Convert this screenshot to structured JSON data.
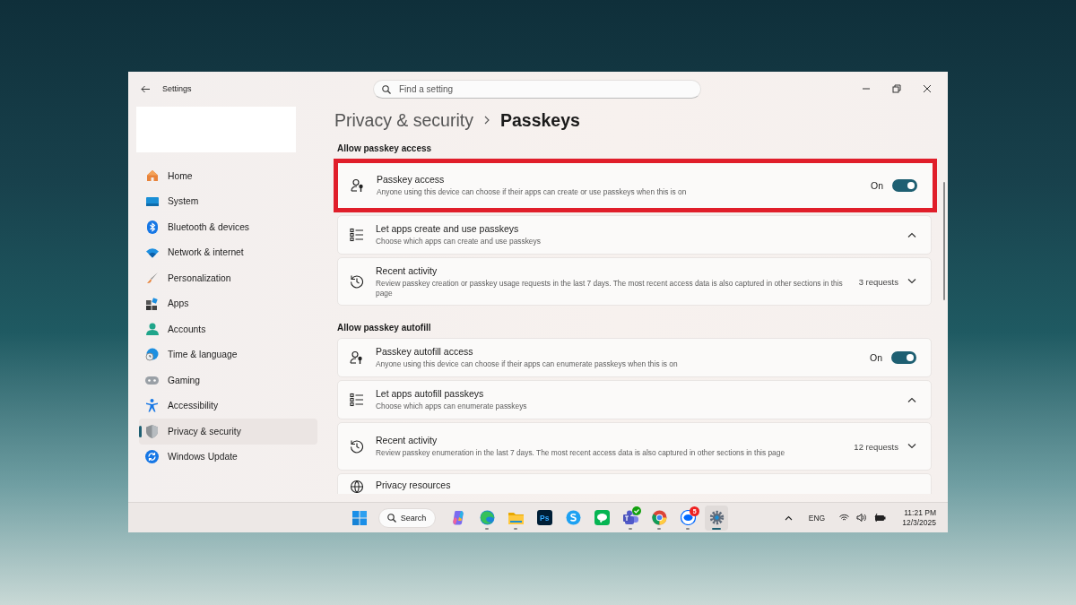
{
  "window": {
    "title": "Settings"
  },
  "search": {
    "placeholder": "Find a setting"
  },
  "sidebar": {
    "items": [
      {
        "label": "Home",
        "selected": false
      },
      {
        "label": "System",
        "selected": false
      },
      {
        "label": "Bluetooth & devices",
        "selected": false
      },
      {
        "label": "Network & internet",
        "selected": false
      },
      {
        "label": "Personalization",
        "selected": false
      },
      {
        "label": "Apps",
        "selected": false
      },
      {
        "label": "Accounts",
        "selected": false
      },
      {
        "label": "Time & language",
        "selected": false
      },
      {
        "label": "Gaming",
        "selected": false
      },
      {
        "label": "Accessibility",
        "selected": false
      },
      {
        "label": "Privacy & security",
        "selected": true
      },
      {
        "label": "Windows Update",
        "selected": false
      }
    ]
  },
  "breadcrumb": {
    "parent": "Privacy & security",
    "current": "Passkeys"
  },
  "sections": [
    {
      "heading": "Allow passkey access",
      "cards": [
        {
          "kind": "toggle",
          "title": "Passkey access",
          "description": "Anyone using this device can choose if their apps can create or use passkeys when this is on",
          "state_label": "On",
          "on": true,
          "highlighted": true
        },
        {
          "kind": "list",
          "title": "Let apps create and use passkeys",
          "description": "Choose which apps can create and use passkeys",
          "expanded": true,
          "highlighted": false
        },
        {
          "kind": "activity",
          "title": "Recent activity",
          "description": "Review passkey creation or passkey usage requests in the last 7 days. The most recent access data is also captured in other sections in this page",
          "count": "3 requests",
          "expanded": false,
          "highlighted": false
        }
      ]
    },
    {
      "heading": "Allow passkey autofill",
      "cards": [
        {
          "kind": "toggle",
          "title": "Passkey autofill access",
          "description": "Anyone using this device can choose if their apps can enumerate passkeys when this is on",
          "state_label": "On",
          "on": true,
          "highlighted": false
        },
        {
          "kind": "list",
          "title": "Let apps autofill passkeys",
          "description": "Choose which apps can enumerate passkeys",
          "expanded": true,
          "highlighted": false
        },
        {
          "kind": "activity",
          "title": "Recent activity",
          "description": "Review passkey enumeration in the last 7 days. The most recent access data is also captured in other sections in this page",
          "count": "12 requests",
          "expanded": false,
          "highlighted": false
        },
        {
          "kind": "link",
          "title": "Privacy resources",
          "highlighted": false
        }
      ]
    }
  ],
  "taskbar": {
    "search_label": "Search",
    "apps": [
      {
        "running": false,
        "active": false
      },
      {
        "running": true,
        "active": false
      },
      {
        "running": true,
        "active": false
      },
      {
        "label": "Ps",
        "running": false,
        "active": false
      },
      {
        "running": false,
        "active": false
      },
      {
        "running": false,
        "active": false
      },
      {
        "running": true,
        "active": false
      },
      {
        "running": true,
        "active": false
      },
      {
        "badge": "5",
        "running": true,
        "active": false
      },
      {
        "running": true,
        "active": true
      }
    ],
    "language": "ENG",
    "time": "11:21 PM",
    "date": "12/3/2025"
  }
}
